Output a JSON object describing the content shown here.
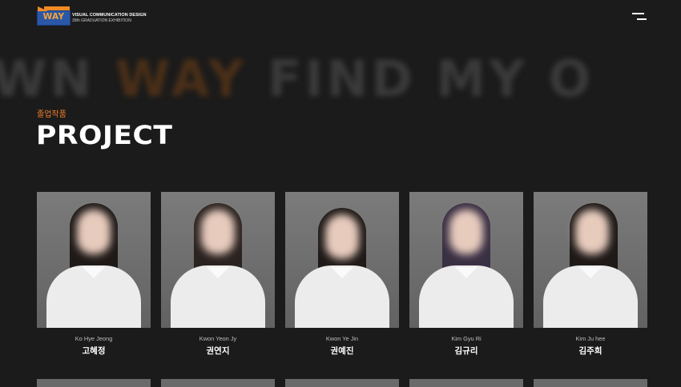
{
  "logo": {
    "mark": "WAY",
    "line1": "VISUAL COMMUNICATION DESIGN",
    "line2": "39th GRADUATION EXHIBITION",
    "icon": "way-logo-icon"
  },
  "menu": {
    "icon": "hamburger-menu-icon"
  },
  "marquee": {
    "before": "WN ",
    "accent": "WAY",
    "after": " FIND MY O"
  },
  "section": {
    "kicker": "졸업작품",
    "title": "PROJECT"
  },
  "projects": [
    {
      "en": "Ko Hye Jeong",
      "ko": "고혜정"
    },
    {
      "en": "Kwon Yeon Jy",
      "ko": "권연지"
    },
    {
      "en": "Kwon Ye Jin",
      "ko": "권예진"
    },
    {
      "en": "Kim Gyu Ri",
      "ko": "김규리"
    },
    {
      "en": "Kim Ju hee",
      "ko": "김주희"
    }
  ],
  "colors": {
    "accent": "#ef7f2a",
    "background": "#1b1b1b",
    "logo_blue": "#2b57a6"
  }
}
